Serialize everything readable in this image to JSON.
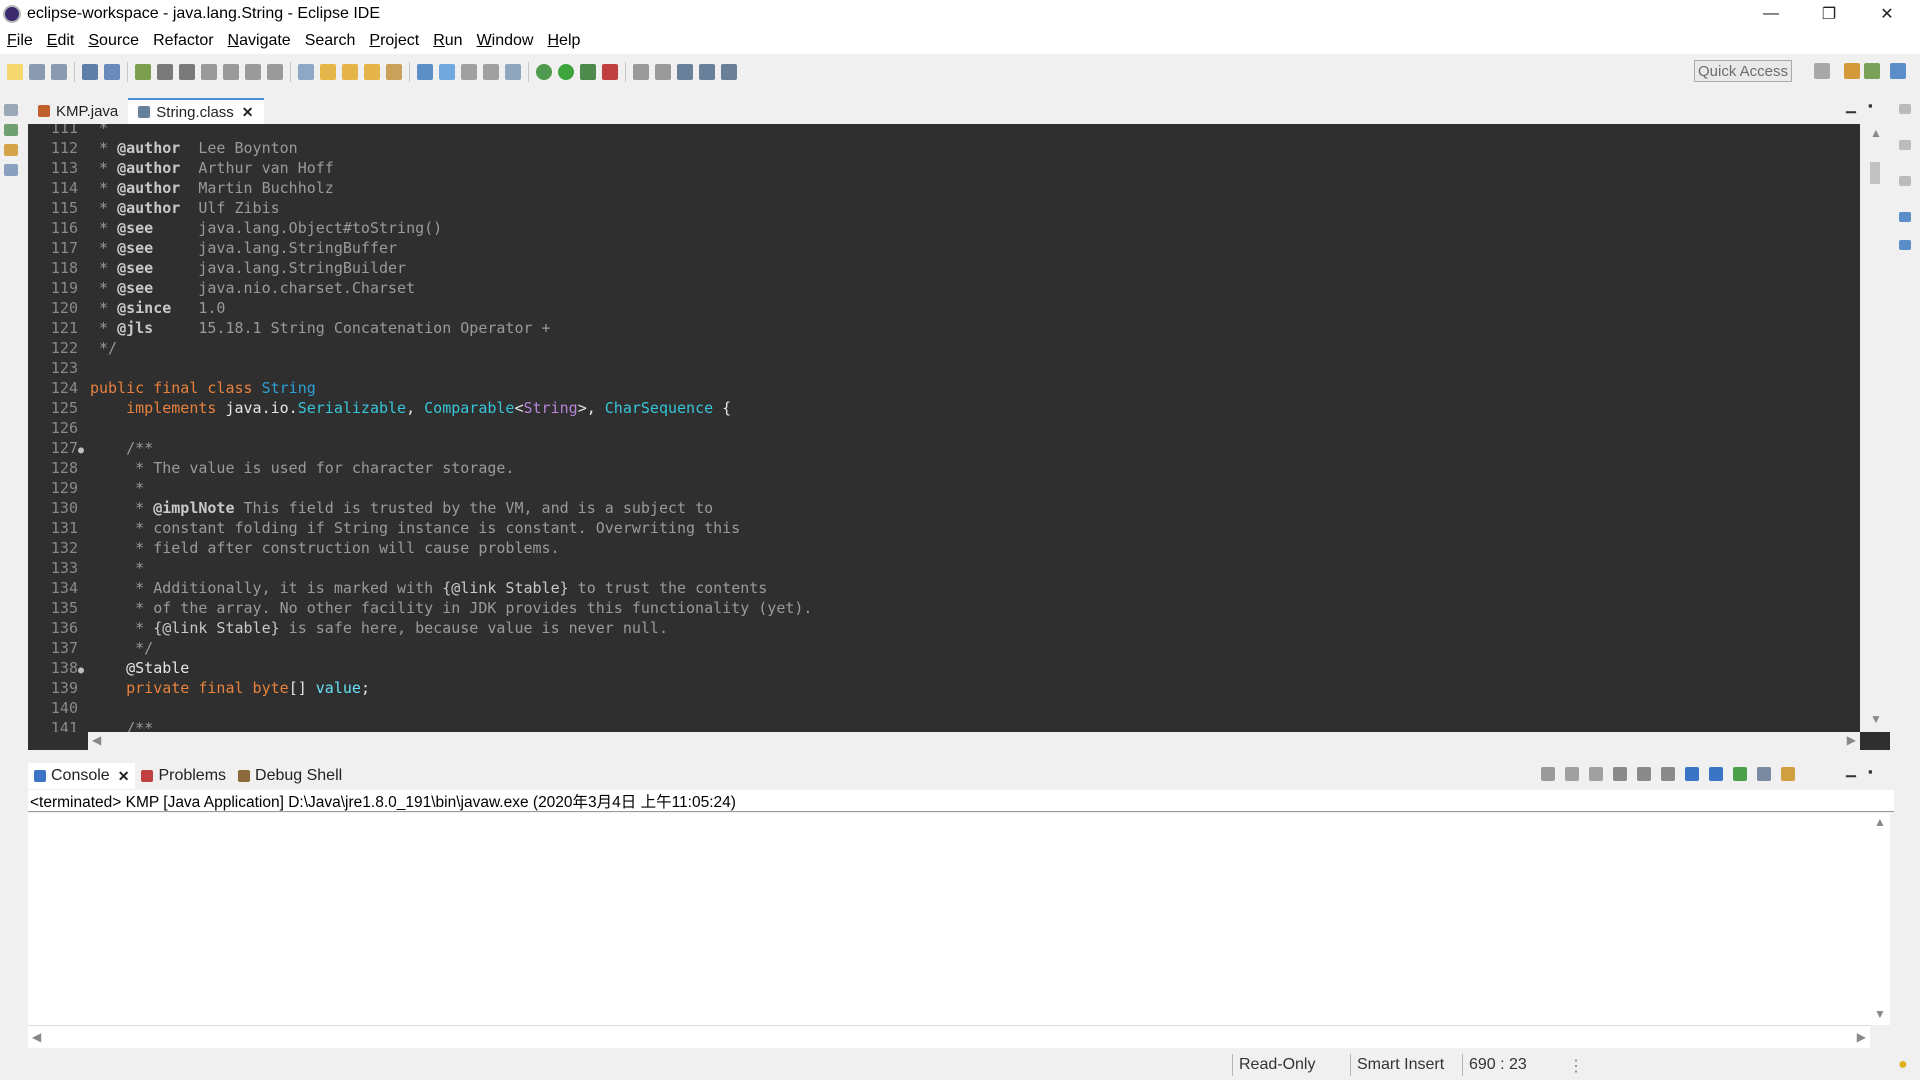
{
  "window": {
    "title": "eclipse-workspace - java.lang.String - Eclipse IDE",
    "controls": {
      "minimize": "—",
      "restore": "❐",
      "close": "✕"
    }
  },
  "menu": [
    {
      "label": "File",
      "u": "F",
      "rest": "ile"
    },
    {
      "label": "Edit",
      "u": "E",
      "rest": "dit"
    },
    {
      "label": "Source",
      "u": "S",
      "rest": "ource"
    },
    {
      "label": "Refactor",
      "u": "",
      "rest": "Refactor"
    },
    {
      "label": "Navigate",
      "u": "N",
      "rest": "avigate"
    },
    {
      "label": "Search",
      "u": "",
      "rest": "Search"
    },
    {
      "label": "Project",
      "u": "P",
      "rest": "roject"
    },
    {
      "label": "Run",
      "u": "R",
      "rest": "un"
    },
    {
      "label": "Window",
      "u": "W",
      "rest": "indow"
    },
    {
      "label": "Help",
      "u": "H",
      "rest": "elp"
    }
  ],
  "toolbar": {
    "quick_access": "Quick Access"
  },
  "editor": {
    "tabs": [
      {
        "label": "KMP.java",
        "active": false
      },
      {
        "label": "String.class",
        "active": true,
        "close": "✕"
      }
    ],
    "lines": [
      {
        "n": "111",
        "fold": "",
        "html": "<span class='c'> *</span>"
      },
      {
        "n": "112",
        "fold": "",
        "html": "<span class='c'> * </span><span class='tg'>@author</span><span class='c'>  Lee Boynton</span>"
      },
      {
        "n": "113",
        "fold": "",
        "html": "<span class='c'> * </span><span class='tg'>@author</span><span class='c'>  Arthur van Hoff</span>"
      },
      {
        "n": "114",
        "fold": "",
        "html": "<span class='c'> * </span><span class='tg'>@author</span><span class='c'>  Martin Buchholz</span>"
      },
      {
        "n": "115",
        "fold": "",
        "html": "<span class='c'> * </span><span class='tg'>@author</span><span class='c'>  Ulf Zibis</span>"
      },
      {
        "n": "116",
        "fold": "",
        "html": "<span class='c'> * </span><span class='tg'>@see</span><span class='c'>     java.lang.Object#toString()</span>"
      },
      {
        "n": "117",
        "fold": "",
        "html": "<span class='c'> * </span><span class='tg'>@see</span><span class='c'>     java.lang.StringBuffer</span>"
      },
      {
        "n": "118",
        "fold": "",
        "html": "<span class='c'> * </span><span class='tg'>@see</span><span class='c'>     java.lang.StringBuilder</span>"
      },
      {
        "n": "119",
        "fold": "",
        "html": "<span class='c'> * </span><span class='tg'>@see</span><span class='c'>     java.nio.charset.Charset</span>"
      },
      {
        "n": "120",
        "fold": "",
        "html": "<span class='c'> * </span><span class='tg'>@since</span><span class='c'>   1.0</span>"
      },
      {
        "n": "121",
        "fold": "",
        "html": "<span class='c'> * </span><span class='tg'>@jls</span><span class='c'>     15.18.1 String Concatenation Operator +</span>"
      },
      {
        "n": "122",
        "fold": "",
        "html": "<span class='c'> */</span>"
      },
      {
        "n": "123",
        "fold": "",
        "html": ""
      },
      {
        "n": "124",
        "fold": "",
        "html": "<span class='kw'>public final class </span><span class='ty'>String</span>"
      },
      {
        "n": "125",
        "fold": "",
        "html": "    <span class='kw'>implements </span><span class='pl'>java.io.</span><span class='tyb'>Serializable</span><span class='pl'>, </span><span class='tyb'>Comparable</span><span class='pl'>&lt;</span><span class='purple'>String</span><span class='pl'>&gt;, </span><span class='tyb'>CharSequence</span><span class='pl'> {</span>"
      },
      {
        "n": "126",
        "fold": "",
        "html": ""
      },
      {
        "n": "127",
        "fold": "●",
        "html": "    <span class='c'>/**</span>"
      },
      {
        "n": "128",
        "fold": "",
        "html": "<span class='c'>     * The value is used for character storage.</span>"
      },
      {
        "n": "129",
        "fold": "",
        "html": "<span class='c'>     *</span>"
      },
      {
        "n": "130",
        "fold": "",
        "html": "<span class='c'>     * </span><span class='tg'>@implNote</span><span class='c'> This field is trusted by the VM, and is a subject to</span>"
      },
      {
        "n": "131",
        "fold": "",
        "html": "<span class='c'>     * constant folding if String instance is constant. Overwriting this</span>"
      },
      {
        "n": "132",
        "fold": "",
        "html": "<span class='c'>     * field after construction will cause problems.</span>"
      },
      {
        "n": "133",
        "fold": "",
        "html": "<span class='c'>     *</span>"
      },
      {
        "n": "134",
        "fold": "",
        "html": "<span class='c'>     * Additionally, it is marked with </span><span class='lk'>{@link Stable}</span><span class='c'> to trust the contents</span>"
      },
      {
        "n": "135",
        "fold": "",
        "html": "<span class='c'>     * of the array. No other facility in JDK provides this functionality (yet).</span>"
      },
      {
        "n": "136",
        "fold": "",
        "html": "<span class='c'>     * </span><span class='lk'>{@link Stable}</span><span class='c'> is safe here, because value is never null.</span>"
      },
      {
        "n": "137",
        "fold": "",
        "html": "<span class='c'>     */</span>"
      },
      {
        "n": "138",
        "fold": "●",
        "html": "    <span class='an'>@Stable</span>"
      },
      {
        "n": "139",
        "fold": "",
        "html": "    <span class='kw'>private final byte</span><span class='pl'>[] </span><span class='vr'>value</span><span class='pl'>;</span>"
      },
      {
        "n": "140",
        "fold": "",
        "html": ""
      },
      {
        "n": "141",
        "fold": "",
        "html": "    <span class='c'>/**</span>"
      }
    ]
  },
  "console": {
    "tabs": [
      {
        "label": "Console",
        "active": true,
        "close": "✕"
      },
      {
        "label": "Problems",
        "active": false
      },
      {
        "label": "Debug Shell",
        "active": false
      }
    ],
    "terminated": "<terminated> KMP [Java Application] D:\\Java\\jre1.8.0_191\\bin\\javaw.exe (2020年3月4日 上午11:05:24)"
  },
  "status": {
    "mode": "Read-Only",
    "insert": "Smart Insert",
    "position": "690 : 23"
  },
  "colors": {
    "editor_bg": "#2f2f2f",
    "keyword": "#e8813e",
    "type": "#2f9fd8",
    "comment": "#9a9a9a"
  }
}
